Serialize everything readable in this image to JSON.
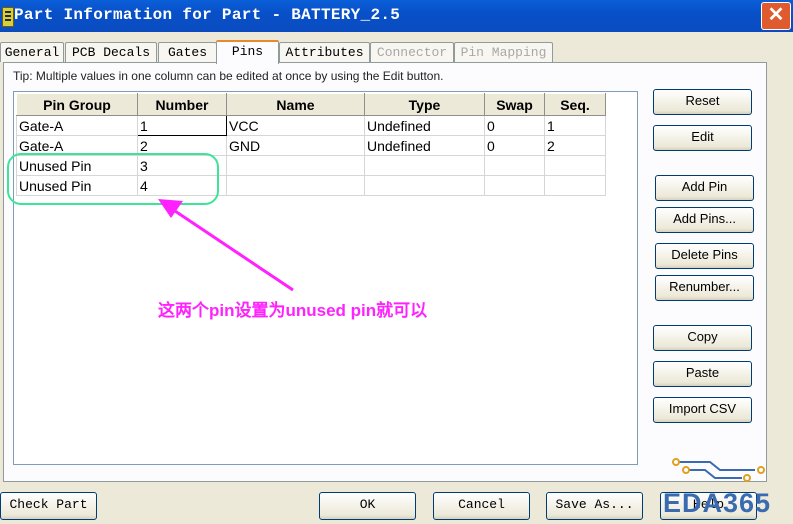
{
  "window": {
    "title": "Part Information for Part - BATTERY_2.5",
    "close_symbol": "✕"
  },
  "tabs": [
    {
      "label": "General",
      "active": false,
      "disabled": false
    },
    {
      "label": "PCB Decals",
      "active": false,
      "disabled": false
    },
    {
      "label": "Gates",
      "active": false,
      "disabled": false
    },
    {
      "label": "Pins",
      "active": true,
      "disabled": false
    },
    {
      "label": "Attributes",
      "active": false,
      "disabled": false
    },
    {
      "label": "Connector",
      "active": false,
      "disabled": true
    },
    {
      "label": "Pin Mapping",
      "active": false,
      "disabled": true
    }
  ],
  "tip": "Tip: Multiple values in one column can be edited at once by using the Edit button.",
  "grid": {
    "columns": [
      "Pin Group",
      "Number",
      "Name",
      "Type",
      "Swap",
      "Seq."
    ],
    "rows": [
      [
        "Gate-A",
        "1",
        "VCC",
        "Undefined",
        "0",
        "1"
      ],
      [
        "Gate-A",
        "2",
        "GND",
        "Undefined",
        "0",
        "2"
      ],
      [
        "Unused Pin",
        "3",
        "",
        "",
        "",
        ""
      ],
      [
        "Unused Pin",
        "4",
        "",
        "",
        "",
        ""
      ]
    ]
  },
  "side_buttons": {
    "reset": "Reset",
    "edit": "Edit",
    "add_pin": "Add Pin",
    "add_pins": "Add Pins...",
    "delete_pins": "Delete Pins",
    "renumber": "Renumber...",
    "copy": "Copy",
    "paste": "Paste",
    "import_csv": "Import CSV"
  },
  "bottom_buttons": {
    "check_part": "Check Part",
    "ok": "OK",
    "cancel": "Cancel",
    "save_as": "Save As...",
    "help": "Help"
  },
  "annotation": {
    "text": "这两个pin设置为unused pin就可以",
    "color": "#ff22ff",
    "highlight_color": "#3ee39a"
  },
  "watermark": "EDA365"
}
